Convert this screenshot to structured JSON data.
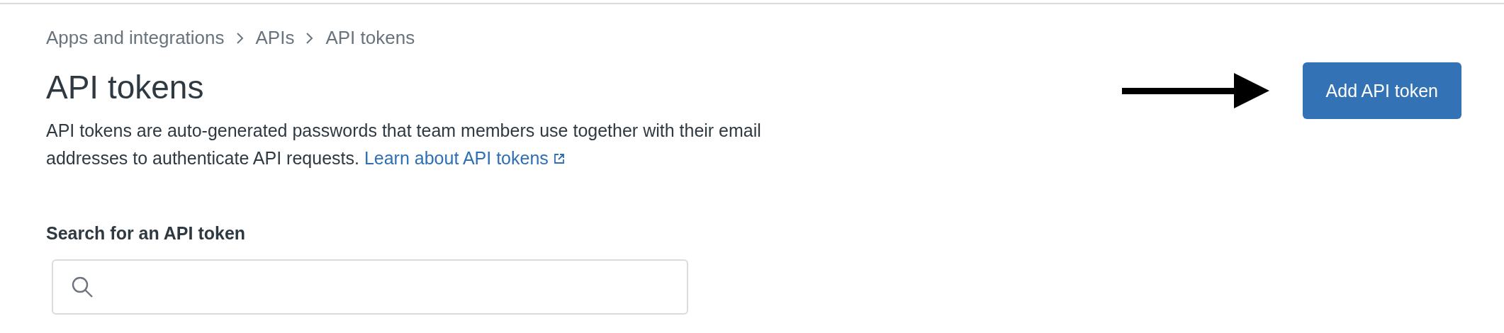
{
  "breadcrumb": [
    {
      "label": "Apps and integrations"
    },
    {
      "label": "APIs"
    },
    {
      "label": "API tokens"
    }
  ],
  "title": "API tokens",
  "description": {
    "text": "API tokens are auto-generated passwords that team members use together with their email addresses to authenticate API requests.",
    "link": "Learn about API tokens"
  },
  "add_button": "Add API token",
  "search": {
    "label": "Search for an API token"
  }
}
